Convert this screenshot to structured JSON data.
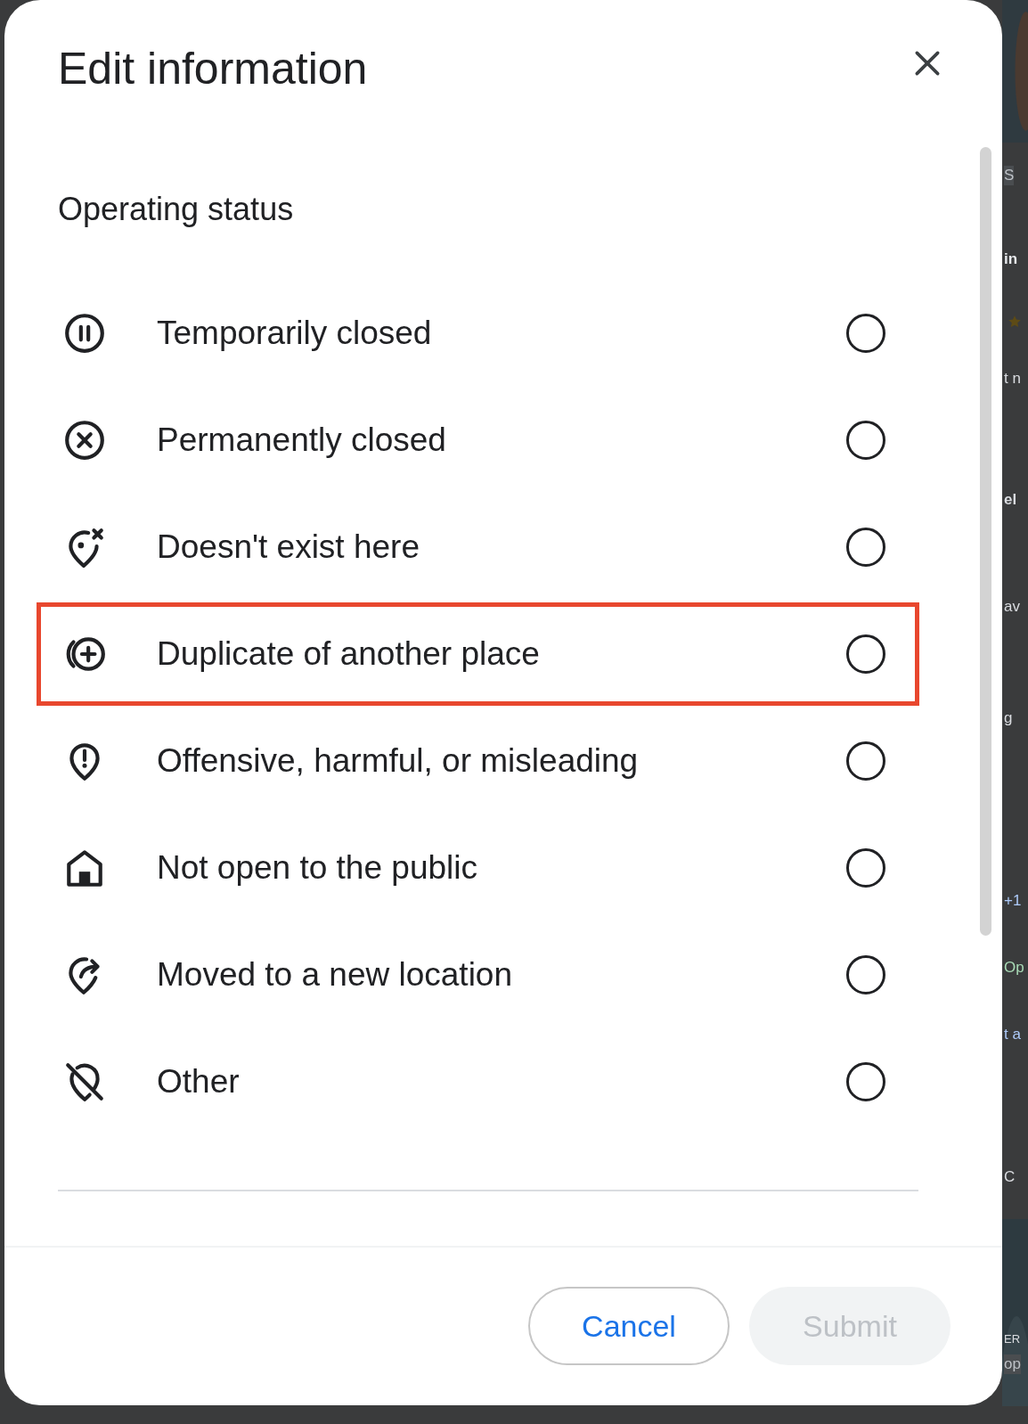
{
  "dialog": {
    "title": "Edit information",
    "section_heading": "Operating status",
    "options": [
      {
        "label": "Temporarily closed",
        "selected": false,
        "highlighted": false
      },
      {
        "label": "Permanently closed",
        "selected": false,
        "highlighted": false
      },
      {
        "label": "Doesn't exist here",
        "selected": false,
        "highlighted": false
      },
      {
        "label": "Duplicate of another place",
        "selected": false,
        "highlighted": true
      },
      {
        "label": "Offensive, harmful, or misleading",
        "selected": false,
        "highlighted": false
      },
      {
        "label": "Not open to the public",
        "selected": false,
        "highlighted": false
      },
      {
        "label": "Moved to a new location",
        "selected": false,
        "highlighted": false
      },
      {
        "label": "Other",
        "selected": false,
        "highlighted": false
      }
    ],
    "buttons": [
      {
        "label": "Cancel",
        "disabled": false
      },
      {
        "label": "Submit",
        "disabled": true
      }
    ]
  },
  "background_page": {
    "fragments": [
      "S",
      "in",
      "t n",
      "el",
      "av",
      "g",
      "+1",
      "Op",
      "t a",
      "C",
      "ER",
      "op"
    ]
  }
}
